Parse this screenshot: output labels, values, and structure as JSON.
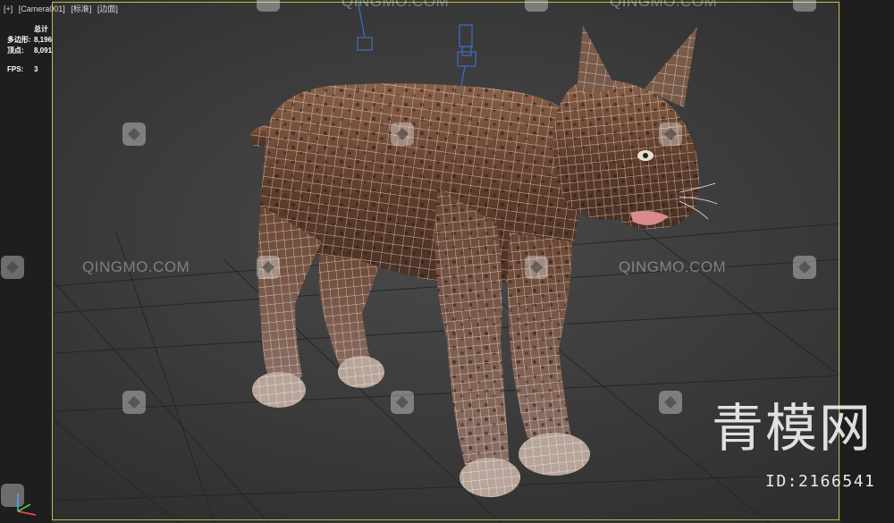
{
  "viewport": {
    "label_parts": [
      "[+]",
      "[Camera001]",
      "[标准]",
      "[边面]"
    ]
  },
  "stats": {
    "total_label": "总计",
    "rows": [
      {
        "key": "多边形:",
        "value": "8,196"
      },
      {
        "key": "顶点:",
        "value": "8,091"
      }
    ],
    "fps_label": "FPS:",
    "fps_value": "3"
  },
  "watermark": {
    "text": "QINGMO.COM",
    "brand_cn": "青模网",
    "brand_id": "ID:2166541"
  },
  "colors": {
    "viewport_bg": "#3c3c3c",
    "safe_frame": "#c8b840",
    "wireframe": "#ffffff",
    "fur": "#6b4530"
  },
  "icons": [
    "camera-target-icon",
    "camera-icon",
    "axis-gizmo-icon",
    "qingmo-logo-icon"
  ]
}
